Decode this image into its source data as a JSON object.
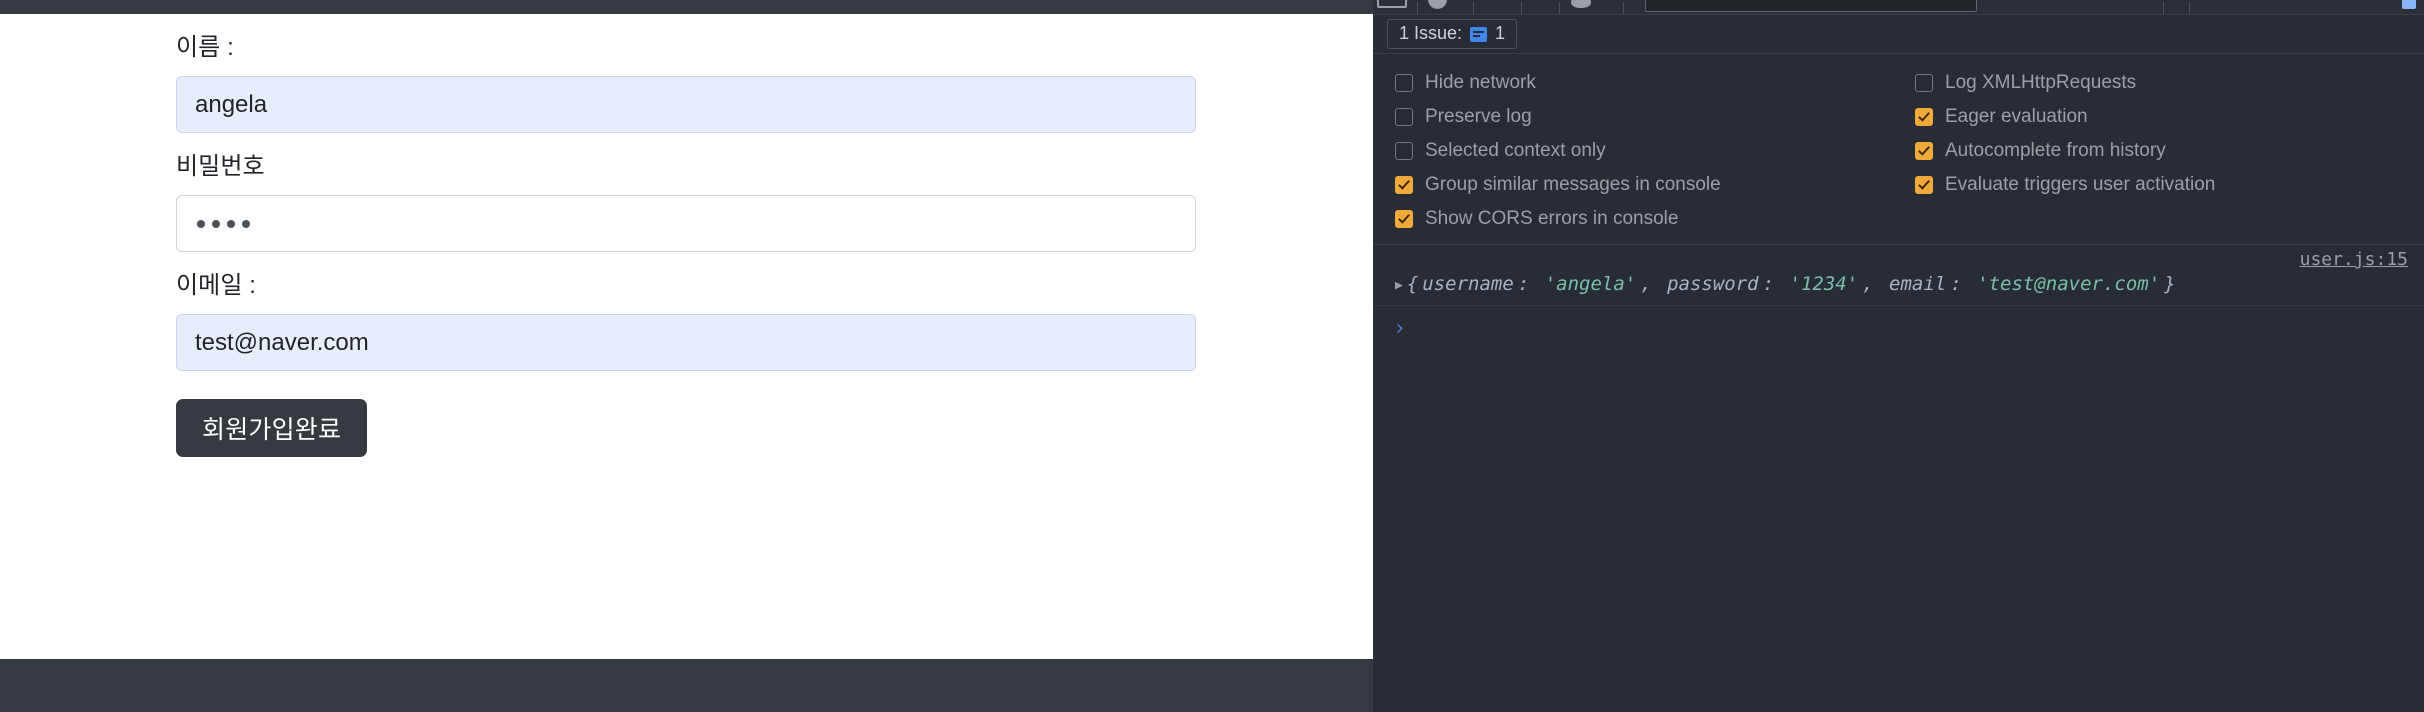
{
  "page": {
    "form": {
      "fields": [
        {
          "label": "이름 :",
          "value": "angela",
          "type": "text",
          "autofilled": true,
          "name": "username"
        },
        {
          "label": "비밀번호",
          "value": "",
          "masked_value": "••••",
          "dot_count": 4,
          "type": "password",
          "autofilled": false,
          "name": "password"
        },
        {
          "label": "이메일 :",
          "value": "test@naver.com",
          "type": "email",
          "autofilled": true,
          "name": "email"
        }
      ],
      "submit_label": "회원가입완료"
    },
    "colors": {
      "topbar": "#343a40",
      "footer": "#343a40",
      "autofill_bg": "#e8edfb",
      "button_bg": "#343a40"
    }
  },
  "devtools": {
    "toolbar": {
      "icons": [
        "clear-console-icon",
        "filter-icon",
        "eye-icon",
        "settings-gear-icon"
      ],
      "filter_placeholder": ""
    },
    "issues": {
      "label": "1 Issue:",
      "count": "1",
      "icon": "message-icon",
      "icon_color": "#4285f4"
    },
    "settings": {
      "left_column": [
        {
          "label": "Hide network",
          "checked": false
        },
        {
          "label": "Preserve log",
          "checked": false
        },
        {
          "label": "Selected context only",
          "checked": false
        },
        {
          "label": "Group similar messages in console",
          "checked": true
        },
        {
          "label": "Show CORS errors in console",
          "checked": true
        }
      ],
      "right_column": [
        {
          "label": "Log XMLHttpRequests",
          "checked": false
        },
        {
          "label": "Eager evaluation",
          "checked": true
        },
        {
          "label": "Autocomplete from history",
          "checked": true
        },
        {
          "label": "Evaluate triggers user activation",
          "checked": true
        }
      ],
      "checked_color": "#f2a93b"
    },
    "console": {
      "source_link": "user.js:15",
      "disclosure": "▶",
      "object": {
        "open_brace": "{",
        "close_brace": "}",
        "entries": [
          {
            "key": "username",
            "sep": ": ",
            "value": "'angela'",
            "trail": ", "
          },
          {
            "key": "password",
            "sep": ": ",
            "value": "'1234'",
            "trail": ", "
          },
          {
            "key": "email",
            "sep": ": ",
            "value": "'test@naver.com'",
            "trail": ""
          }
        ]
      },
      "prompt_chevron": "›",
      "prompt_value": ""
    }
  }
}
